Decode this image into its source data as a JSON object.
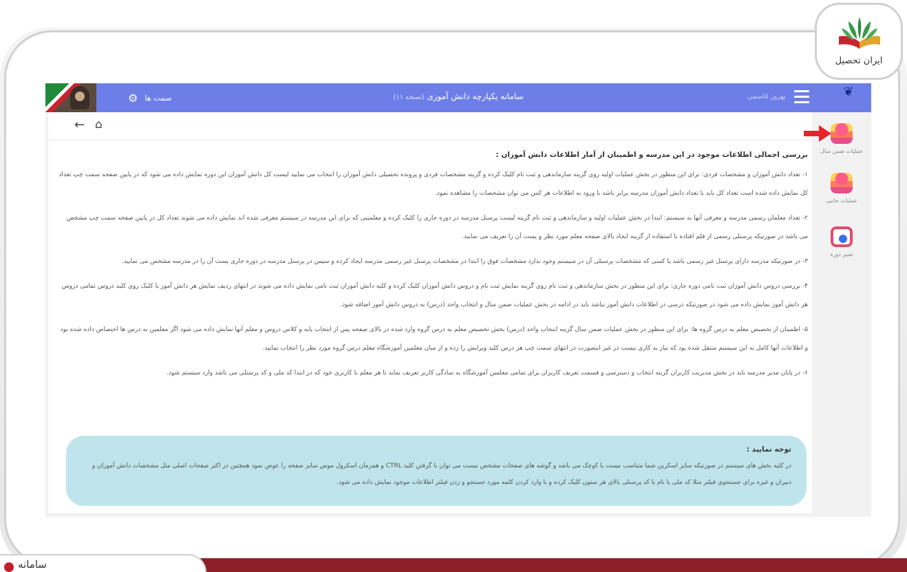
{
  "logo": {
    "text": "ایران تحصیل"
  },
  "bottom_tab": {
    "text": "سامانه"
  },
  "topbar": {
    "services_label": "سمت ها",
    "title": "سامانه یکپارچه دانش آموزی",
    "version": "(نسخه ۱۱)",
    "user_name": "بهروز قاسمی"
  },
  "sidebar": {
    "items": [
      {
        "label": "عملیات ضمن سال",
        "icon": "cake-icon"
      },
      {
        "label": "عملیات جانبی",
        "icon": "cake-icon"
      },
      {
        "label": "تغییر دوره",
        "icon": "settings-ring-icon"
      }
    ]
  },
  "content": {
    "heading": "بررسی اجمالی اطلاعات موجود در این مدرسه و اطمینان از آمار اطلاعات دانش آموزان :",
    "paragraphs": [
      "۱- تعداد دانش آموزان و مشخصات فردی: برای این منظور در بخش عملیات اولیه روی گزینه سازماندهی و ثبت نام کلیک کرده و گزینه مشخصات فردی و پرونده تحصیلی دانش آموزان را انتخاب می نمایید لیست کل دانش آموزان این دوره نمایش داده می شود که در پایین صفحه سمت چپ تعداد کل نمایش داده شده است تعداد کل باید با تعداد دانش آموزان مدرسه برابر باشد با ورود به اطلاعات هر کس می توان مشخصات را مشاهده نمود.",
      "۲- تعداد معلمان رسمی مدرسه و معرفی آنها به سیستم: ابتدا در بخش عملیات اولیه و سازماندهی و ثبت نام گزینه لیست پرسنل مدرسه در دوره جاری را کلیک کرده و معلمینی که برای این مدرسه در سیستم معرفی شده اند نمایش داده می شوند تعداد کل در پایین صفحه سمت چپ مشخص می باشد در صورتیکه پرسنلی رسمی از قلم افتاده با استفاده از گزینه ایجاد بالای صفحه معلم مورد نظر و پست آن را تعریف می نمایید.",
      "۳- در صورتیکه مدرسه دارای پرسنل غیر رسمی باشد یا کسی که مشخصات پرسنلی آن در سیستم وجود ندارد مشخصات فوق را ابتدا در مشخصات پرسنل غیر رسمی مدرسه ایجاد کرده و سپس در پرسنل مدرسه در دوره جاری پست آن را در مدرسه مشخص می نمایید.",
      "۴- بررسی دروس دانش آموزان ثبت نامی دوره جاری: برای این منظور در بخش سازماندهی و ثبت نام روی گزینه نمایش ثبت نام و دروس دانش آموزان کلیک کرده و کلیه دانش آموزان ثبت نامی نمایش داده می شوند در انتهای ردیف نمایش هر دانش آموز با کلیک روی کلید دروس تمامی دروس هر دانش آموز نمایش داده می شود در صورتیکه درسی در اطلاعات دانش آموز نباشد باید در ادامه در بخش عملیات ضمن سال و انتخاب واحد (درس) به دروس دانش آموز اضافه شود.",
      "۵- اطمینان از تخصیص معلم به درس گروه ها: برای این منظور در بخش عملیات ضمن سال گزینه انتخاب واحد (درس) بخش تخصیص معلم به درس گروه وارد شده در بالای صفحه پس از انتخاب پایه و کلاس دروس و معلم آنها نمایش داده می شود اگر معلمین به درس ها اختصاص داده شده بود و اطلاعات آنها کامل به این سیستم منتقل شده بود که نیاز به کاری نیست در غیر اینصورت در انتهای سمت چپ هر درس کلید ویرایش را زده و از میان معلمین آموزشگاه معلم درس گروه مورد نظر را انتخاب نمایید.",
      "۶- در پایان مدیر مدرسه باید در بخش مدیریت کاربران گزینه انتخاب و دسترسی و قسمت تعریف کاربران برای تمامی معلمین آموزشگاه به سادگی کاربر تعریف نماید تا هر معلم با کاربری خود که در ابتدا کد ملی و کد پرسنلی می باشد وارد سیستم شود."
    ]
  },
  "notice": {
    "title": "توجه نمایید :",
    "body": "در کلیه بخش های سیستم در صورتیکه سایز اسکرین شما متناسب نیست یا کوچک می باشد و گوشه های صفحات مشخص نیست می توان با گرفتن کلید CTRL و همزمان اسکرول موس سایز صفحه را عوض نمود همچنین در اکثر صفحات اصلی مثل مشخصات دانش آموزان و دبیران و غیره برای جستجوی فیلتر مثلا کد ملی یا نام یا کد پرسنلی بالای هر ستون کلیک کرده و با وارد کردن کلمه مورد جستجو و زدن فیلتر اطلاعات موجود نمایش داده می شود."
  },
  "colors": {
    "topbar": "#6e7ee9",
    "notice_bg": "#bfe4ec",
    "bottom_bar": "#8c1f28",
    "arrow": "#e8232b"
  }
}
